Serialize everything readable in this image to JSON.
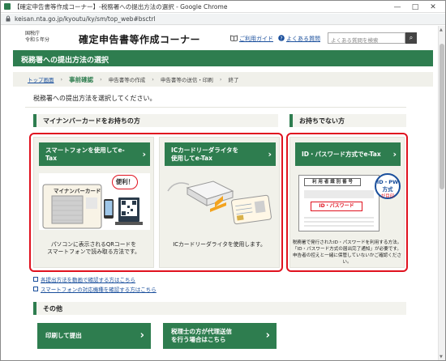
{
  "window": {
    "title": "【確定申告書等作成コーナー】-税務署への提出方法の選択 - Google Chrome",
    "url": "keisan.nta.go.jp/kyoutu/ky/sm/top_web#bsctrl",
    "minimize": "—",
    "maximize": "□",
    "close": "✕"
  },
  "header": {
    "agency": "国税庁",
    "era": "令和５年分",
    "title": "確定申告書等作成コーナー",
    "guide_link": "ご利用ガイド",
    "faq_link": "よくある質問",
    "search_placeholder": "よくある質問を検索",
    "search_icon": "⌕"
  },
  "banner": {
    "title": "税務署への提出方法の選択"
  },
  "breadcrumb": {
    "home": "トップ画面",
    "current": "事前確認",
    "steps": [
      "申告書等の作成",
      "申告書等の送信・印刷",
      "終了"
    ],
    "sep": "›"
  },
  "intro": "税務署への提出方法を選択してください。",
  "sections": {
    "mynumber": {
      "title": "マイナンバーカードをお持ちの方"
    },
    "nocard": {
      "title": "お持ちでない方"
    },
    "other": {
      "title": "その他"
    }
  },
  "cards": {
    "smartphone": {
      "button": "スマートフォンを使用してe-Tax",
      "card_label": "マイナンバーカード",
      "badge": "便利！",
      "desc1": "パソコンに表示されるQRコードを",
      "desc2": "スマートフォンで読み取る方法です。"
    },
    "icreader": {
      "button_line1": "ICカードリーダライタを",
      "button_line2": "使用してe-Tax",
      "desc": "ICカードリーダライタを使用します。"
    },
    "idpw": {
      "button": "ID・パスワード方式でe-Tax",
      "doc_title": "利 用 者 識 別 番 号",
      "doc_subtitle": "ID・パスワード",
      "stamp": "ID・PW 方式",
      "stamp_line2": "が目印",
      "desc1": "税務署で発行されたID・パスワードを利用する方法。",
      "desc2": "「ID・パスワード方式の届出完了通知」が必要です。",
      "desc3": "申告者の控えと一緒に保管していないかご確認ください。"
    }
  },
  "links": {
    "video": "各提出方法を動画で確認する方はこちら",
    "devices": "スマートフォンの対応機種を確認する方はこちら"
  },
  "other_buttons": {
    "print": "印刷して提出",
    "tax_accountant_line1": "税理士の方が代理送信",
    "tax_accountant_line2": "を行う場合はこちら"
  },
  "chevron": "›",
  "colors": {
    "accent_green": "#2e7d4f",
    "highlight_red": "#e0121f",
    "link_blue": "#1a4f9c"
  }
}
